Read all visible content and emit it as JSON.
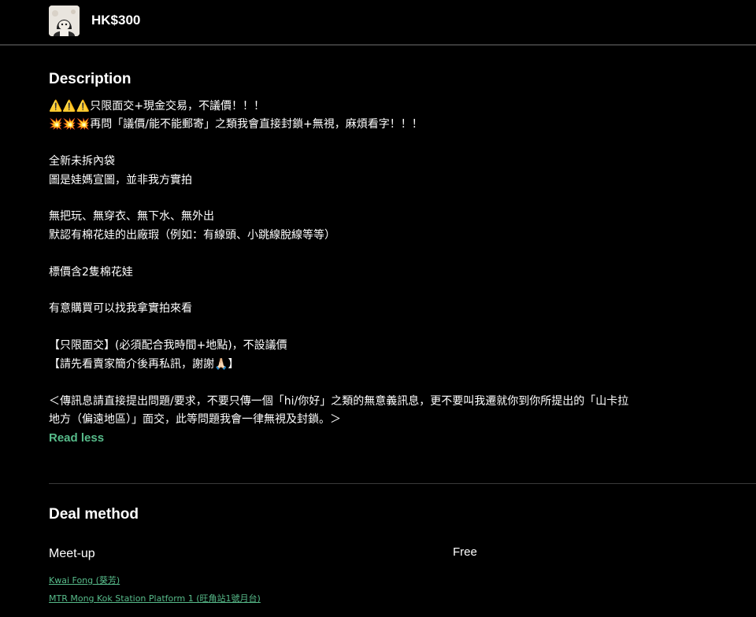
{
  "header": {
    "thumbnail_icon": "cotton-doll-photo",
    "price": "HK$300"
  },
  "description": {
    "title": "Description",
    "body": "⚠️⚠️⚠️只限面交+現金交易，不議價！！！\n💥💥💥再問「議價/能不能郵寄」之類我會直接封鎖+無視，麻煩看字！！！\n\n全新未拆內袋\n圖是娃媽宣圖，並非我方實拍\n\n無把玩、無穿衣、無下水、無外出\n默認有棉花娃的出廠瑕（例如：有線頭、小跳線脫線等等）\n\n標價含2隻棉花娃\n\n有意購買可以找我拿實拍來看\n\n【只限面交】(必須配合我時間+地點)，不設議價\n【請先看賣家簡介後再私訊，謝謝🙏🏻】\n\n＜傳訊息請直接提出問題/要求，不要只傳一個「hi/你好」之類的無意義訊息，更不要叫我遷就你到你所提出的「山卡拉地方（偏遠地區）」面交，此等問題我會一律無視及封鎖。＞",
    "read_less": "Read less"
  },
  "deal": {
    "title": "Deal method",
    "method": "Meet-up",
    "fee": "Free",
    "locations": [
      "Kwai Fong (葵芳)",
      "MTR Mong Kok Station Platform 1 (旺角站1號月台)"
    ]
  },
  "colors": {
    "background": "#000000",
    "text": "#ffffff",
    "accent": "#57bb8a",
    "divider": "#3a3a3a"
  }
}
